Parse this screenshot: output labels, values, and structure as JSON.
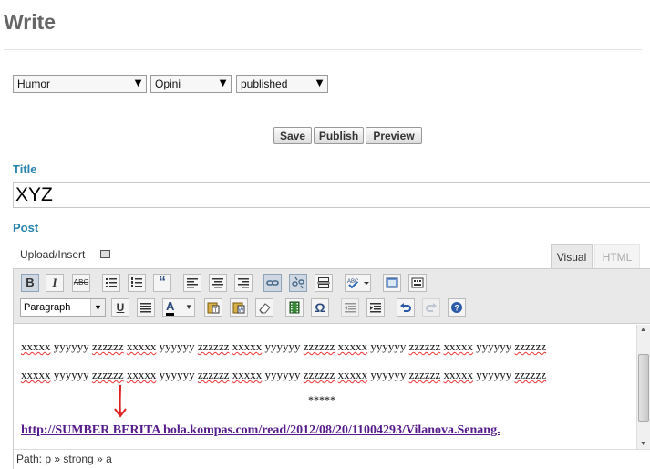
{
  "page": {
    "title": "Write"
  },
  "selects": {
    "category": "Humor",
    "type": "Opini",
    "status": "published"
  },
  "actions": {
    "save": "Save",
    "publish": "Publish",
    "preview": "Preview"
  },
  "labels": {
    "title": "Title",
    "post": "Post"
  },
  "post_title": "XYZ",
  "upload_insert": "Upload/Insert",
  "tabs": {
    "visual": "Visual",
    "html": "HTML"
  },
  "toolbar": {
    "format": "Paragraph",
    "bold": "B",
    "italic": "I",
    "strikethrough": "ABC",
    "quote": "“",
    "underline": "U",
    "omega": "Ω",
    "font_color": "A"
  },
  "content": {
    "words": [
      "xxxxx",
      "yyyyyy",
      "zzzzzz"
    ],
    "line_repeats": 5,
    "separator": "*****",
    "link": "http://SUMBER BERITA bola.kompas.com/read/2012/08/20/11004293/Vilanova.Senang."
  },
  "status_path": "Path: p » strong » a",
  "colors": {
    "accent": "#2583ad",
    "link": "#551a8b",
    "annotation": "#e02020"
  }
}
